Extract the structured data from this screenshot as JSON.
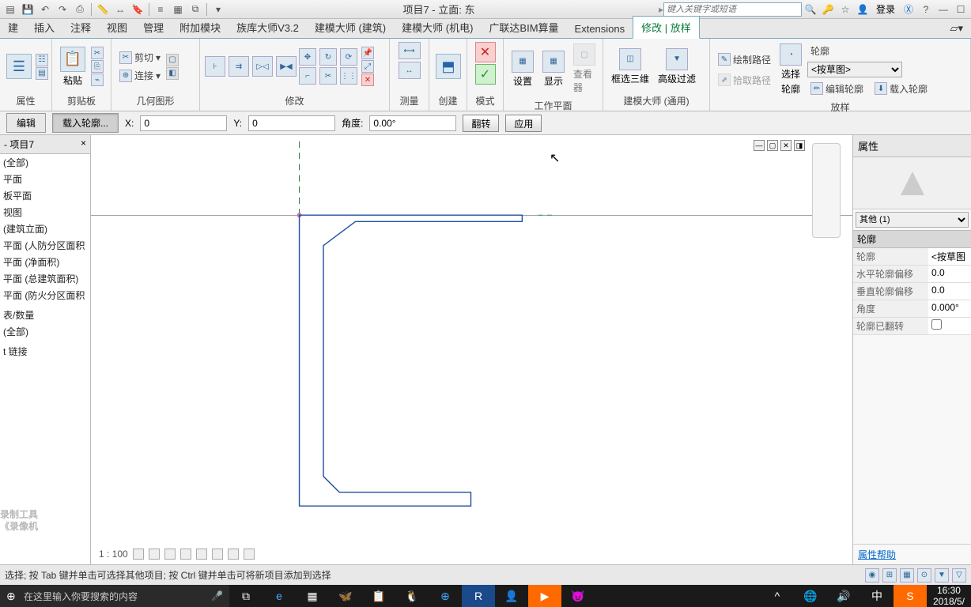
{
  "title": "项目7 - 立面: 东",
  "search_placeholder": "键入关键字或短语",
  "login": "登录",
  "menu": [
    "建",
    "插入",
    "注释",
    "视图",
    "管理",
    "附加模块",
    "族库大师V3.2",
    "建模大师 (建筑)",
    "建模大师 (机电)",
    "广联达BIM算量",
    "Extensions",
    "修改 | 放样"
  ],
  "panels": {
    "p1": "属性",
    "p2": "剪贴板",
    "p3": "几何图形",
    "p4": "修改",
    "p5": "测量",
    "p6": "创建",
    "p7": "模式",
    "p8": "工作平面",
    "p9": "建模大师 (通用)",
    "p10": "放样",
    "paste": "粘贴",
    "cut": "剪切",
    "join": "连接",
    "set": "设置",
    "show": "显示",
    "viewer": "查看器",
    "box3d": "框选三维",
    "advfilter": "高级过滤",
    "draw_path": "绘制路径",
    "pick_path": "拾取路径",
    "select_prof": "选择",
    "profile": "轮廓",
    "prof_drop": "<按草图>",
    "edit_prof": "编辑轮廓",
    "load_prof": "载入轮廓"
  },
  "opts": {
    "edit": "编辑",
    "load": "载入轮廓...",
    "x": "X:",
    "xv": "0",
    "y": "Y:",
    "yv": "0",
    "ang": "角度:",
    "angv": "0.00°",
    "flip": "翻转",
    "apply": "应用"
  },
  "browser": {
    "title": "- 项目7",
    "items": [
      "(全部)",
      "平面",
      "板平面",
      "视图",
      "(建筑立面)",
      "平面 (人防分区面积",
      "平面 (净面积)",
      "平面 (总建筑面积)",
      "平面 (防火分区面积",
      "",
      "表/数量",
      "(全部)",
      "",
      "t 链接"
    ]
  },
  "props": {
    "title": "属性",
    "type": "其他 (1)",
    "section": "轮廓",
    "rows": [
      {
        "k": "轮廓",
        "v": "<按草图"
      },
      {
        "k": "水平轮廓偏移",
        "v": "0.0"
      },
      {
        "k": "垂直轮廓偏移",
        "v": "0.0"
      },
      {
        "k": "角度",
        "v": "0.000°"
      },
      {
        "k": "轮廓已翻转",
        "v": ""
      }
    ],
    "help": "属性帮助"
  },
  "view_scale": "1 : 100",
  "status_text": "选择; 按 Tab 键并单击可选择其他项目; 按 Ctrl 键并单击可将新项目添加到选择",
  "taskbar": {
    "search": "在这里输入你要搜索的内容",
    "time": "16:30",
    "date": "2018/5/",
    "ime": "中"
  },
  "watermark_l1": "录制工具",
  "watermark_l2": "《录像机"
}
